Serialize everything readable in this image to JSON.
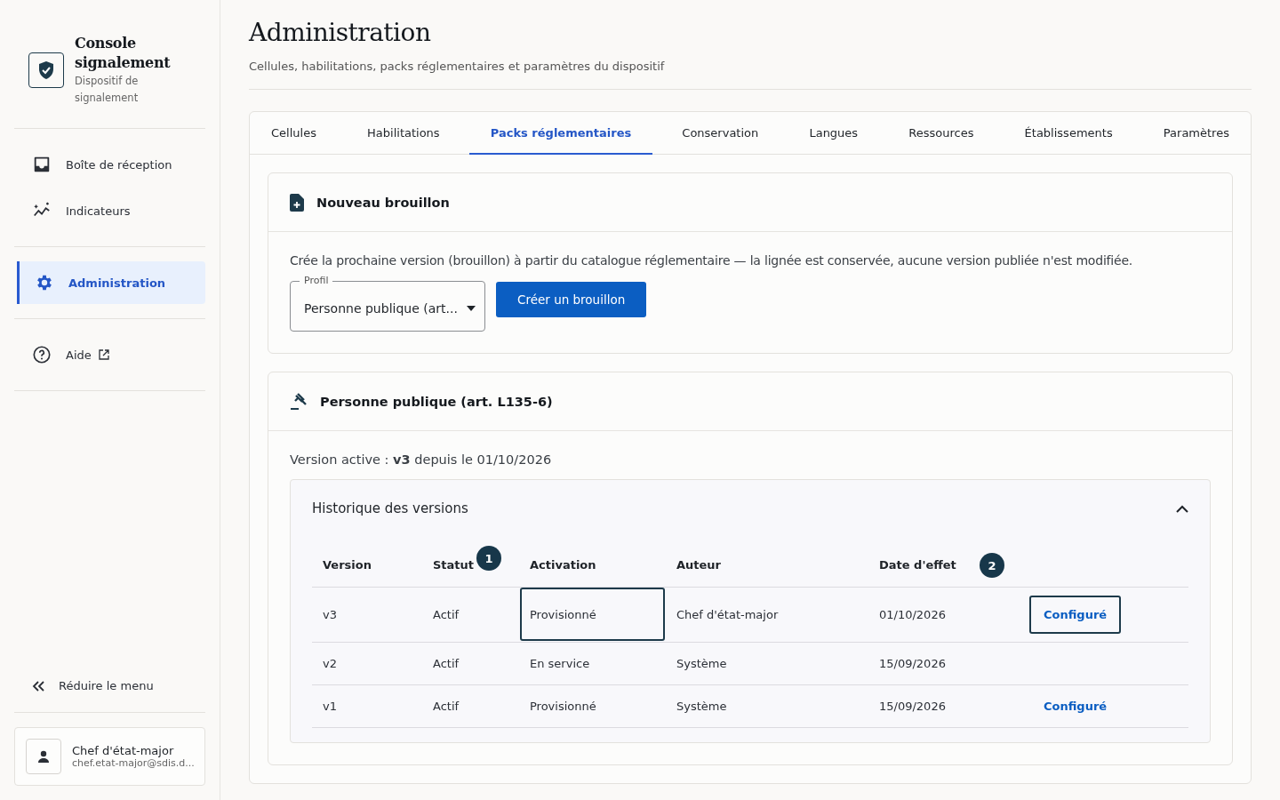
{
  "sidebar": {
    "app_title": "Console signalement",
    "app_subtitle": "Dispositif de signalement",
    "nav_groups": [
      [
        {
          "label": "Boîte de réception",
          "kind": "inbox",
          "selected": false
        },
        {
          "label": "Indicateurs",
          "kind": "chart",
          "selected": false
        }
      ],
      [
        {
          "label": "Administration",
          "kind": "gear",
          "selected": true
        }
      ],
      [
        {
          "label": "Aide",
          "kind": "help",
          "selected": false,
          "external": true
        }
      ]
    ],
    "collapse": "Réduire le menu",
    "user": {
      "name": "Chef d'état-major",
      "email": "chef.etat-major@sdis.d..."
    }
  },
  "page": {
    "title": "Administration",
    "subtitle": "Cellules, habilitations, packs réglementaires et paramètres du dispositif"
  },
  "tabs": [
    {
      "label": "Cellules",
      "selected": false
    },
    {
      "label": "Habilitations",
      "selected": false
    },
    {
      "label": "Packs réglementaires",
      "selected": true
    },
    {
      "label": "Conservation",
      "selected": false
    },
    {
      "label": "Langues",
      "selected": false
    },
    {
      "label": "Ressources",
      "selected": false
    },
    {
      "label": "Établissements",
      "selected": false
    },
    {
      "label": "Paramètres",
      "selected": false
    }
  ],
  "draft_card": {
    "title": "Nouveau brouillon",
    "description": "Crée la prochaine version (brouillon) à partir du catalogue réglementaire — la lignée est conservée, aucune version publiée n'est modifiée.",
    "profile_field": {
      "label": "Profil",
      "value": "Personne publique (art..."
    },
    "button": "Créer un brouillon"
  },
  "pack_card": {
    "title": "Personne publique (art. L135-6)",
    "active_version": "Version active : **v3** depuis le 01/10/2026",
    "history": {
      "title": "Historique des versions",
      "expanded": true,
      "columns": [
        "Version",
        "Statut",
        "Activation",
        "Auteur",
        "Date d'effet"
      ],
      "callouts": [
        "1",
        "2"
      ],
      "rows": [
        {
          "cells": [
            {
              "text": "v3",
              "highlighted": false
            },
            {
              "text": "Actif",
              "highlighted": false
            },
            {
              "text": "Provisionné",
              "highlighted": true
            },
            {
              "text": "Chef d'état-major",
              "highlighted": false
            },
            {
              "text": "01/10/2026",
              "highlighted": false
            }
          ],
          "action": {
            "label": "Configuré",
            "highlighted": true
          }
        },
        {
          "cells": [
            {
              "text": "v2",
              "highlighted": false
            },
            {
              "text": "Actif",
              "highlighted": false
            },
            {
              "text": "En service",
              "highlighted": false
            },
            {
              "text": "Système",
              "highlighted": false
            },
            {
              "text": "15/09/2026",
              "highlighted": false
            }
          ]
        },
        {
          "cells": [
            {
              "text": "v1",
              "highlighted": false
            },
            {
              "text": "Actif",
              "highlighted": false
            },
            {
              "text": "Provisionné",
              "highlighted": false
            },
            {
              "text": "Système",
              "highlighted": false
            },
            {
              "text": "15/09/2026",
              "highlighted": false
            }
          ],
          "action": {
            "label": "Configuré",
            "highlighted": false
          }
        }
      ]
    }
  }
}
